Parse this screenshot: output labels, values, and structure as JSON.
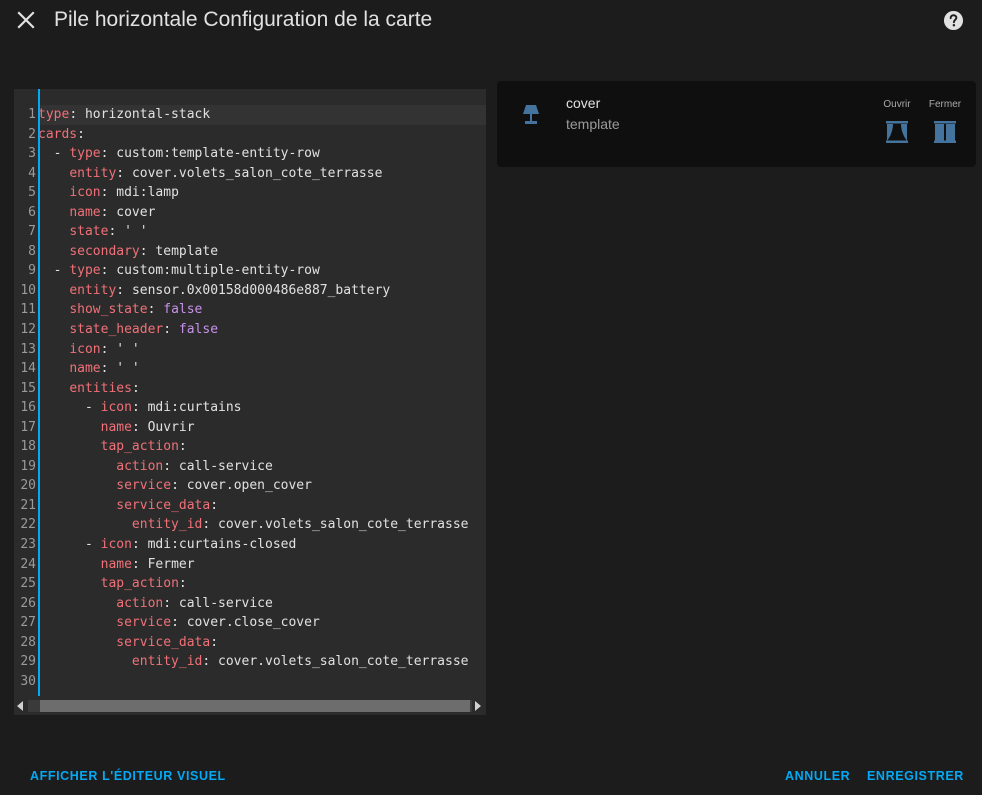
{
  "dialog": {
    "title": "Pile horizontale Configuration de la carte",
    "close_icon": "close-icon",
    "help_icon": "help-circle-icon"
  },
  "editor": {
    "lines": [
      [
        [
          "k",
          "type"
        ],
        [
          "p",
          ": "
        ],
        [
          "v",
          "horizontal-stack"
        ]
      ],
      [
        [
          "k",
          "cards"
        ],
        [
          "p",
          ":"
        ]
      ],
      [
        [
          "p",
          "  - "
        ],
        [
          "k",
          "type"
        ],
        [
          "p",
          ": "
        ],
        [
          "v",
          "custom:template-entity-row"
        ]
      ],
      [
        [
          "p",
          "    "
        ],
        [
          "k",
          "entity"
        ],
        [
          "p",
          ": "
        ],
        [
          "v",
          "cover.volets_salon_cote_terrasse"
        ]
      ],
      [
        [
          "p",
          "    "
        ],
        [
          "k",
          "icon"
        ],
        [
          "p",
          ": "
        ],
        [
          "v",
          "mdi:lamp"
        ]
      ],
      [
        [
          "p",
          "    "
        ],
        [
          "k",
          "name"
        ],
        [
          "p",
          ": "
        ],
        [
          "v",
          "cover"
        ]
      ],
      [
        [
          "p",
          "    "
        ],
        [
          "k",
          "state"
        ],
        [
          "p",
          ": "
        ],
        [
          "v",
          "' '"
        ]
      ],
      [
        [
          "p",
          "    "
        ],
        [
          "k",
          "secondary"
        ],
        [
          "p",
          ": "
        ],
        [
          "v",
          "template"
        ]
      ],
      [
        [
          "p",
          "  - "
        ],
        [
          "k",
          "type"
        ],
        [
          "p",
          ": "
        ],
        [
          "v",
          "custom:multiple-entity-row"
        ]
      ],
      [
        [
          "p",
          "    "
        ],
        [
          "k",
          "entity"
        ],
        [
          "p",
          ": "
        ],
        [
          "v",
          "sensor.0x00158d000486e887_battery"
        ]
      ],
      [
        [
          "p",
          "    "
        ],
        [
          "k",
          "show_state"
        ],
        [
          "p",
          ": "
        ],
        [
          "b",
          "false"
        ]
      ],
      [
        [
          "p",
          "    "
        ],
        [
          "k",
          "state_header"
        ],
        [
          "p",
          ": "
        ],
        [
          "b",
          "false"
        ]
      ],
      [
        [
          "p",
          "    "
        ],
        [
          "k",
          "icon"
        ],
        [
          "p",
          ": "
        ],
        [
          "v",
          "' '"
        ]
      ],
      [
        [
          "p",
          "    "
        ],
        [
          "k",
          "name"
        ],
        [
          "p",
          ": "
        ],
        [
          "v",
          "' '"
        ]
      ],
      [
        [
          "p",
          "    "
        ],
        [
          "k",
          "entities"
        ],
        [
          "p",
          ":"
        ]
      ],
      [
        [
          "p",
          "      - "
        ],
        [
          "k",
          "icon"
        ],
        [
          "p",
          ": "
        ],
        [
          "v",
          "mdi:curtains"
        ]
      ],
      [
        [
          "p",
          "        "
        ],
        [
          "k",
          "name"
        ],
        [
          "p",
          ": "
        ],
        [
          "v",
          "Ouvrir"
        ]
      ],
      [
        [
          "p",
          "        "
        ],
        [
          "k",
          "tap_action"
        ],
        [
          "p",
          ":"
        ]
      ],
      [
        [
          "p",
          "          "
        ],
        [
          "k",
          "action"
        ],
        [
          "p",
          ": "
        ],
        [
          "v",
          "call-service"
        ]
      ],
      [
        [
          "p",
          "          "
        ],
        [
          "k",
          "service"
        ],
        [
          "p",
          ": "
        ],
        [
          "v",
          "cover.open_cover"
        ]
      ],
      [
        [
          "p",
          "          "
        ],
        [
          "k",
          "service_data"
        ],
        [
          "p",
          ":"
        ]
      ],
      [
        [
          "p",
          "            "
        ],
        [
          "k",
          "entity_id"
        ],
        [
          "p",
          ": "
        ],
        [
          "v",
          "cover.volets_salon_cote_terrasse"
        ]
      ],
      [
        [
          "p",
          "      - "
        ],
        [
          "k",
          "icon"
        ],
        [
          "p",
          ": "
        ],
        [
          "v",
          "mdi:curtains-closed"
        ]
      ],
      [
        [
          "p",
          "        "
        ],
        [
          "k",
          "name"
        ],
        [
          "p",
          ": "
        ],
        [
          "v",
          "Fermer"
        ]
      ],
      [
        [
          "p",
          "        "
        ],
        [
          "k",
          "tap_action"
        ],
        [
          "p",
          ":"
        ]
      ],
      [
        [
          "p",
          "          "
        ],
        [
          "k",
          "action"
        ],
        [
          "p",
          ": "
        ],
        [
          "v",
          "call-service"
        ]
      ],
      [
        [
          "p",
          "          "
        ],
        [
          "k",
          "service"
        ],
        [
          "p",
          ": "
        ],
        [
          "v",
          "cover.close_cover"
        ]
      ],
      [
        [
          "p",
          "          "
        ],
        [
          "k",
          "service_data"
        ],
        [
          "p",
          ":"
        ]
      ],
      [
        [
          "p",
          "            "
        ],
        [
          "k",
          "entity_id"
        ],
        [
          "p",
          ": "
        ],
        [
          "v",
          "cover.volets_salon_cote_terrasse"
        ]
      ],
      []
    ]
  },
  "preview": {
    "icon": "lamp-icon",
    "name": "cover",
    "secondary": "template",
    "entities": [
      {
        "label": "Ouvrir",
        "icon": "curtains-icon"
      },
      {
        "label": "Fermer",
        "icon": "curtains-closed-icon"
      }
    ]
  },
  "footer": {
    "visual_editor_label": "AFFICHER L'ÉDITEUR VISUEL",
    "cancel_label": "ANNULER",
    "save_label": "ENREGISTRER"
  },
  "colors": {
    "accent": "#03a9f4",
    "yaml_key": "#f07178",
    "yaml_bool": "#c792ea",
    "icon": "#44739e"
  }
}
